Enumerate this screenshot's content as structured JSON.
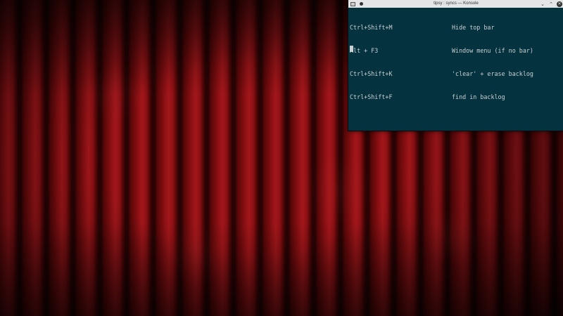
{
  "window": {
    "title": "tipsy : syncs — Konsole",
    "buttons": {
      "minimize": "⌄",
      "maximize": "⌃",
      "close": "✕"
    }
  },
  "terminal": {
    "lines": [
      {
        "key": "Ctrl+Shift+M",
        "desc": "Hide top bar"
      },
      {
        "key": "Alt + F3",
        "desc": "Window menu (if no bar)"
      },
      {
        "key": "Ctrl+Shift+K",
        "desc": "'clear' + erase backlog"
      },
      {
        "key": "Ctrl+Shift+F",
        "desc": "find in backlog"
      }
    ]
  },
  "colors": {
    "terminal_bg": "#04323f",
    "terminal_fg": "#c9d1d3",
    "titlebar_bg": "#e3e5e7",
    "wallpaper_red": "#8c1014"
  },
  "icons": [
    "konsole-app-icon",
    "pin-icon",
    "minimize-icon",
    "maximize-icon",
    "close-icon"
  ]
}
